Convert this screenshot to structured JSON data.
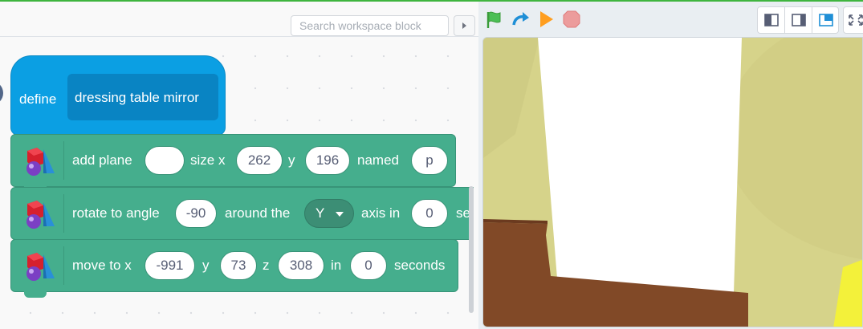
{
  "workspace": {
    "search_placeholder": "Search workspace block"
  },
  "define_block": {
    "keyword": "define",
    "name": "dressing table mirror",
    "color": "#0b9fe3"
  },
  "blocks": {
    "add_plane": {
      "label_add": "add plane",
      "color_value": "",
      "label_size": "size x",
      "x_value": "262",
      "label_y": "y",
      "y_value": "196",
      "label_named": "named",
      "name_value": "p"
    },
    "rotate": {
      "label_rotate": "rotate to angle",
      "angle_value": "-90",
      "label_around": "around the",
      "axis_value": "Y",
      "label_axis_in": "axis in",
      "time_value": "0",
      "label_seconds": "se"
    },
    "move": {
      "label_move": "move to x",
      "x_value": "-991",
      "label_y": "y",
      "y_value": "73",
      "label_z": "z",
      "z_value": "308",
      "label_in": "in",
      "time_value": "0",
      "label_seconds": "seconds"
    },
    "color": "#45ae8d"
  },
  "toolbar": {
    "icons": [
      "green-flag-icon",
      "redo-icon",
      "run-icon",
      "stop-icon"
    ],
    "view_icons": [
      "small-stage-icon",
      "normal-stage-icon",
      "overlay-stage-icon",
      "fullscreen-icon"
    ]
  },
  "stage": {
    "wall_color": "#d6d38a",
    "mirror_color": "#ffffff",
    "table_color": "#814927",
    "accent_color": "#f3f13a"
  }
}
